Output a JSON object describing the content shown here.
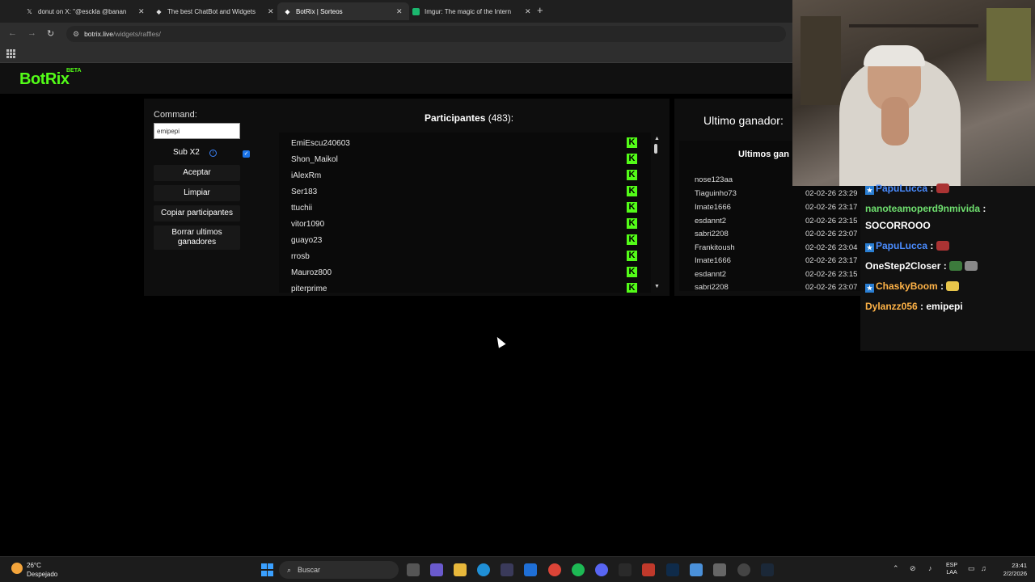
{
  "browser": {
    "tabs": [
      {
        "title": "donut on X: \"@esckla @banan",
        "icon": "x-logo-icon",
        "active": false
      },
      {
        "title": "The best ChatBot and Widgets",
        "icon": "botrix-icon",
        "active": false
      },
      {
        "title": "BotRix | Sorteos",
        "icon": "botrix-icon",
        "active": true
      },
      {
        "title": "Imgur: The magic of the Intern",
        "icon": "imgur-icon",
        "active": false
      }
    ],
    "url_host": "botrix.live",
    "url_path": "/widgets/raffles/"
  },
  "site": {
    "logo": "BotRix",
    "beta": "BETA",
    "brand_color": "#53fc18"
  },
  "raffle": {
    "command_label": "Command:",
    "command_value": "emipepi",
    "sub_x2_label": "Sub X2",
    "sub_x2_checked": true,
    "buttons": {
      "accept": "Aceptar",
      "clear": "Limpiar",
      "copy": "Copiar participantes",
      "delete_winners": "Borrar ultimos ganadores"
    },
    "participants_label": "Participantes",
    "participants_count": "(483):",
    "participants": [
      "EmiEscu240603",
      "Shon_Maikol",
      "iAlexRm",
      "Ser183",
      "ttuchii",
      "vitor1090",
      "guayo23",
      "rrosb",
      "Mauroz800",
      "piterprime"
    ],
    "last_winner_label": "Ultimo ganador:",
    "winners_label": "Ultimos gan",
    "winners": [
      {
        "name": "nose123aa",
        "date": ""
      },
      {
        "name": "Tiaguinho73",
        "date": "02-02-26 23:29"
      },
      {
        "name": "Imate1666",
        "date": "02-02-26 23:17"
      },
      {
        "name": "esdannt2",
        "date": "02-02-26 23:15"
      },
      {
        "name": "sabri2208",
        "date": "02-02-26 23:07"
      },
      {
        "name": "Frankitoush",
        "date": "02-02-26 23:04"
      },
      {
        "name": "Imate1666",
        "date": "02-02-26 23:17"
      },
      {
        "name": "esdannt2",
        "date": "02-02-26 23:15"
      },
      {
        "name": "sabri2208",
        "date": "02-02-26 23:07"
      }
    ]
  },
  "chat": [
    {
      "user": "PapuLucca",
      "color": "#4a8cff",
      "badge": true,
      "msg": ":",
      "emote": "#a33"
    },
    {
      "user": "nanoteamoperd9nmivida",
      "color": "#6fe06f",
      "badge": false,
      "msg": ":",
      "emote": ""
    },
    {
      "user": "",
      "color": "#fff",
      "badge": false,
      "msg": "SOCORROOO",
      "emote": ""
    },
    {
      "user": "PapuLucca",
      "color": "#4a8cff",
      "badge": true,
      "msg": ":",
      "emote": "#a33"
    },
    {
      "user": "OneStep2Closer",
      "color": "#fff",
      "badge": false,
      "msg": ":",
      "emote": "#3c7a3c"
    },
    {
      "user": "ChaskyBoom",
      "color": "#ffb347",
      "badge": true,
      "msg": ":",
      "emote": "#e8c54a"
    },
    {
      "user": "Dylanzz056",
      "color": "#ffb347",
      "badge": false,
      "msg": ": emipepi",
      "emote": ""
    }
  ],
  "taskbar": {
    "temperature": "26°C",
    "weather": "Despejado",
    "search_placeholder": "Buscar",
    "lang_top": "ESP",
    "lang_bottom": "LAA",
    "time": "23:41",
    "date": "2/2/2026"
  }
}
